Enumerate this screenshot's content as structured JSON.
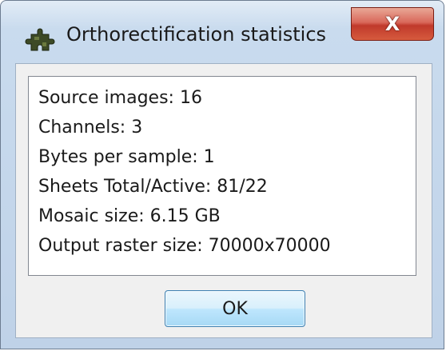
{
  "window": {
    "title": "Orthorectification statistics",
    "app_icon": "puzzle-piece-icon",
    "close_glyph": "X"
  },
  "stats": {
    "lines": [
      "Source images: 16",
      "Channels: 3",
      "Bytes per sample: 1",
      "Sheets Total/Active: 81/22",
      "Mosaic size: 6.15 GB",
      "Output raster size: 70000x70000"
    ]
  },
  "buttons": {
    "ok_label": "OK"
  },
  "colors": {
    "titlebar": "#c9dbee",
    "close_button": "#c0392b",
    "ok_button_border": "#3c7fb1"
  }
}
